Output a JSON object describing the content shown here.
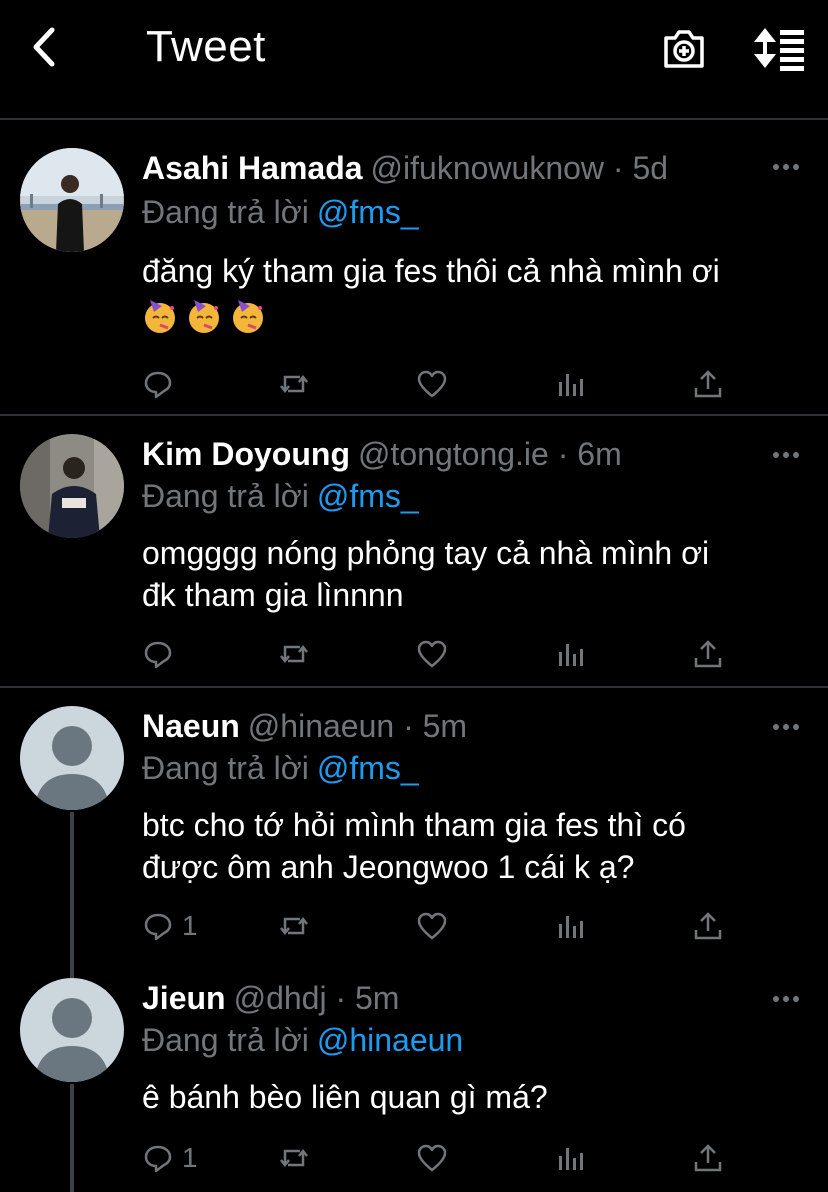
{
  "header": {
    "title": "Tweet",
    "back_icon": "chevron-left-icon",
    "camera_icon": "camera-plus-icon",
    "sort_icon": "sort-icon"
  },
  "colors": {
    "background": "#000000",
    "text": "#ffffff",
    "muted": "#71767b",
    "accent": "#1d9bf0",
    "divider": "#2f3336"
  },
  "replying_prefix": "Đang trả lời",
  "tweets": [
    {
      "name": "Asahi Hamada",
      "handle": "@ifuknowuknow · 5d",
      "reply_to": "@fms_",
      "text_lines": [
        "đăng ký tham gia fes thôi cả nhà mình ơi"
      ],
      "emoji": [
        "partying-face",
        "partying-face",
        "partying-face"
      ],
      "reply_count": "",
      "avatar": "photo"
    },
    {
      "name": "Kim Doyoung",
      "handle": "@tongtong.ie · 6m",
      "reply_to": "@fms_",
      "text_lines": [
        "omgggg nóng phỏng tay cả nhà mình ơi",
        "đk tham gia lìnnnn"
      ],
      "reply_count": "",
      "avatar": "photo"
    },
    {
      "name": "Naeun",
      "handle": "@hinaeun · 5m",
      "reply_to": "@fms_",
      "text_lines": [
        "btc cho tớ hỏi mình tham gia fes thì có",
        "được ôm anh Jeongwoo 1 cái k ạ?"
      ],
      "reply_count": "1",
      "avatar": "default"
    },
    {
      "name": "Jieun",
      "handle": "@dhdj · 5m",
      "reply_to": "@hinaeun",
      "text_lines": [
        "ê bánh bèo liên quan gì má?"
      ],
      "reply_count": "1",
      "avatar": "default"
    }
  ]
}
